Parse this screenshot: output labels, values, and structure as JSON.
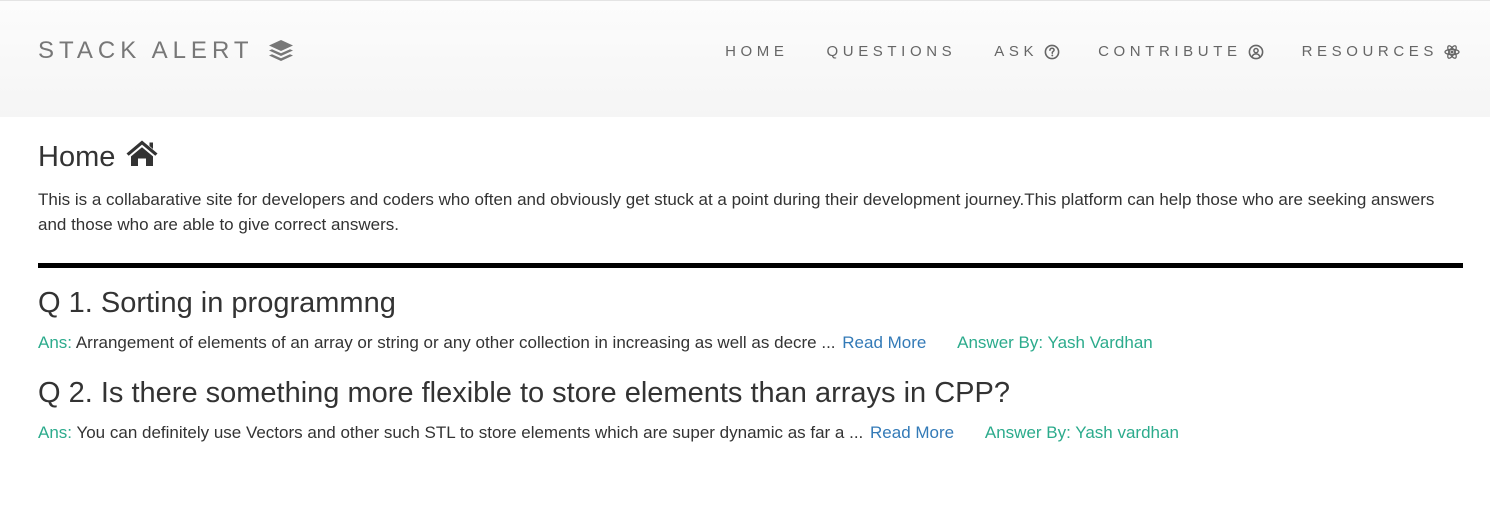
{
  "navbar": {
    "brand": "STACK ALERT",
    "brand_icon": "layers-icon",
    "items": [
      {
        "label": "HOME",
        "icon": ""
      },
      {
        "label": "QUESTIONS",
        "icon": ""
      },
      {
        "label": "ASK",
        "icon": "question-circle-icon"
      },
      {
        "label": "CONTRIBUTE",
        "icon": "user-circle-icon"
      },
      {
        "label": "RESOURCES",
        "icon": "react-icon"
      }
    ]
  },
  "main": {
    "title": "Home",
    "title_icon": "home-icon",
    "intro": "This is a collabarative site for developers and coders who often and obviously get stuck at a point during their development journey.This platform can help those who are seeking answers and those who are able to give correct answers.",
    "questions": [
      {
        "title": "Q 1. Sorting in programmng",
        "ans_label": "Ans:",
        "answer": "Arrangement of elements of an array or string or any other collection in increasing as well as decre ...",
        "read_more": "Read More",
        "answer_by": "Answer By: Yash Vardhan"
      },
      {
        "title": "Q 2. Is there something more flexible to store elements than arrays in CPP?",
        "ans_label": "Ans:",
        "answer": "You can definitely use Vectors and other such STL to store elements which are super dynamic as far a ...",
        "read_more": "Read More",
        "answer_by": "Answer By: Yash vardhan"
      }
    ]
  },
  "colors": {
    "accent_green": "#2cab8c",
    "link_blue": "#337ab7",
    "nav_text": "#666666",
    "divider": "#000000"
  }
}
